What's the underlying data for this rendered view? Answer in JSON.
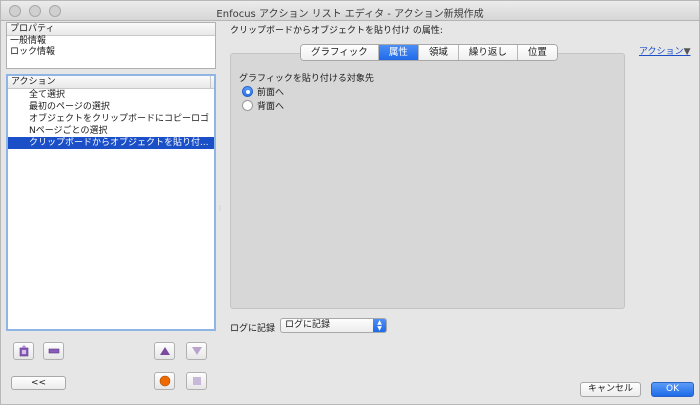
{
  "window": {
    "title": "Enfocus アクション リスト エディタ - アクション新規作成"
  },
  "properties": {
    "header": "プロパティ",
    "items": [
      "一般情報",
      "ロック情報"
    ]
  },
  "actions": {
    "header": "アクション",
    "items": [
      {
        "label": "全て選択",
        "selected": false
      },
      {
        "label": "最初のページの選択",
        "selected": false
      },
      {
        "label": "オブジェクトをクリップボードにコピーロゴ",
        "selected": false
      },
      {
        "label": "Nページごとの選択",
        "selected": false
      },
      {
        "label": "クリップボードからオブジェクトを貼り付...",
        "selected": true
      }
    ]
  },
  "left_buttons": {
    "collapse_label": "<<"
  },
  "attributes": {
    "label": "クリップボードからオブジェクトを貼り付け の属性:",
    "action_menu": "アクション",
    "action_menu_arrow": "▼",
    "tabs": [
      {
        "label": "グラフィック",
        "active": false
      },
      {
        "label": "属性",
        "active": true
      },
      {
        "label": "領域",
        "active": false
      },
      {
        "label": "繰り返し",
        "active": false
      },
      {
        "label": "位置",
        "active": false
      }
    ],
    "target_label": "グラフィックを貼り付ける対象先",
    "radio_front": "前面へ",
    "radio_back": "背面へ",
    "selected_radio": "front"
  },
  "log": {
    "label": "ログに記録",
    "value": "ログに記録"
  },
  "footer": {
    "cancel_label": "キャンセル",
    "ok_label": "OK"
  },
  "colors": {
    "accent": "#1f6ae8",
    "selection": "#1a4fc8",
    "record_dot": "#ee6a00",
    "triangle": "#7a4aa0"
  },
  "icons": {
    "add": "add-action-icon",
    "remove": "remove-action-icon",
    "up": "move-up-icon",
    "down": "move-down-icon",
    "record": "record-icon",
    "stop": "stop-icon"
  }
}
